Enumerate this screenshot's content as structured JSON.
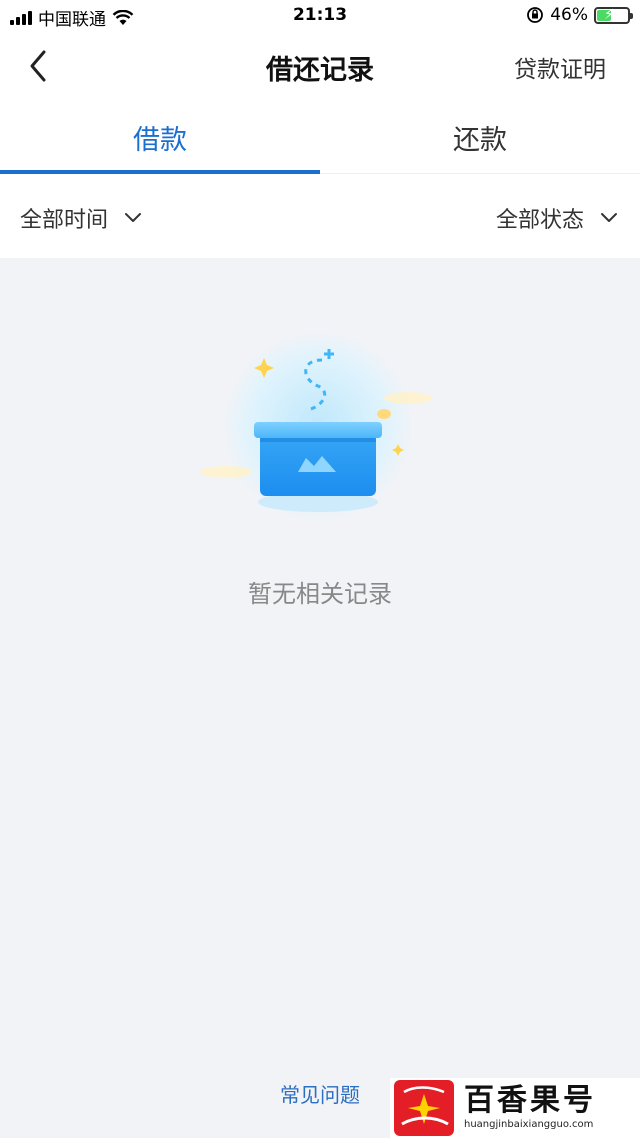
{
  "status_bar": {
    "carrier": "中国联通",
    "time": "21:13",
    "battery_percent": "46%",
    "battery_level": 0.46
  },
  "nav": {
    "title": "借还记录",
    "action": "贷款证明"
  },
  "tabs": [
    {
      "label": "借款",
      "active": true
    },
    {
      "label": "还款",
      "active": false
    }
  ],
  "filters": {
    "time": "全部时间",
    "status": "全部状态"
  },
  "empty_state": {
    "message": "暂无相关记录"
  },
  "footer": {
    "faq_link": "常见问题"
  },
  "watermark": {
    "brand": "百香果号",
    "url": "huangjinbaixiangguo.com"
  },
  "colors": {
    "accent": "#1b6fd0",
    "background": "#f2f3f7",
    "link": "#2b6fc2"
  }
}
